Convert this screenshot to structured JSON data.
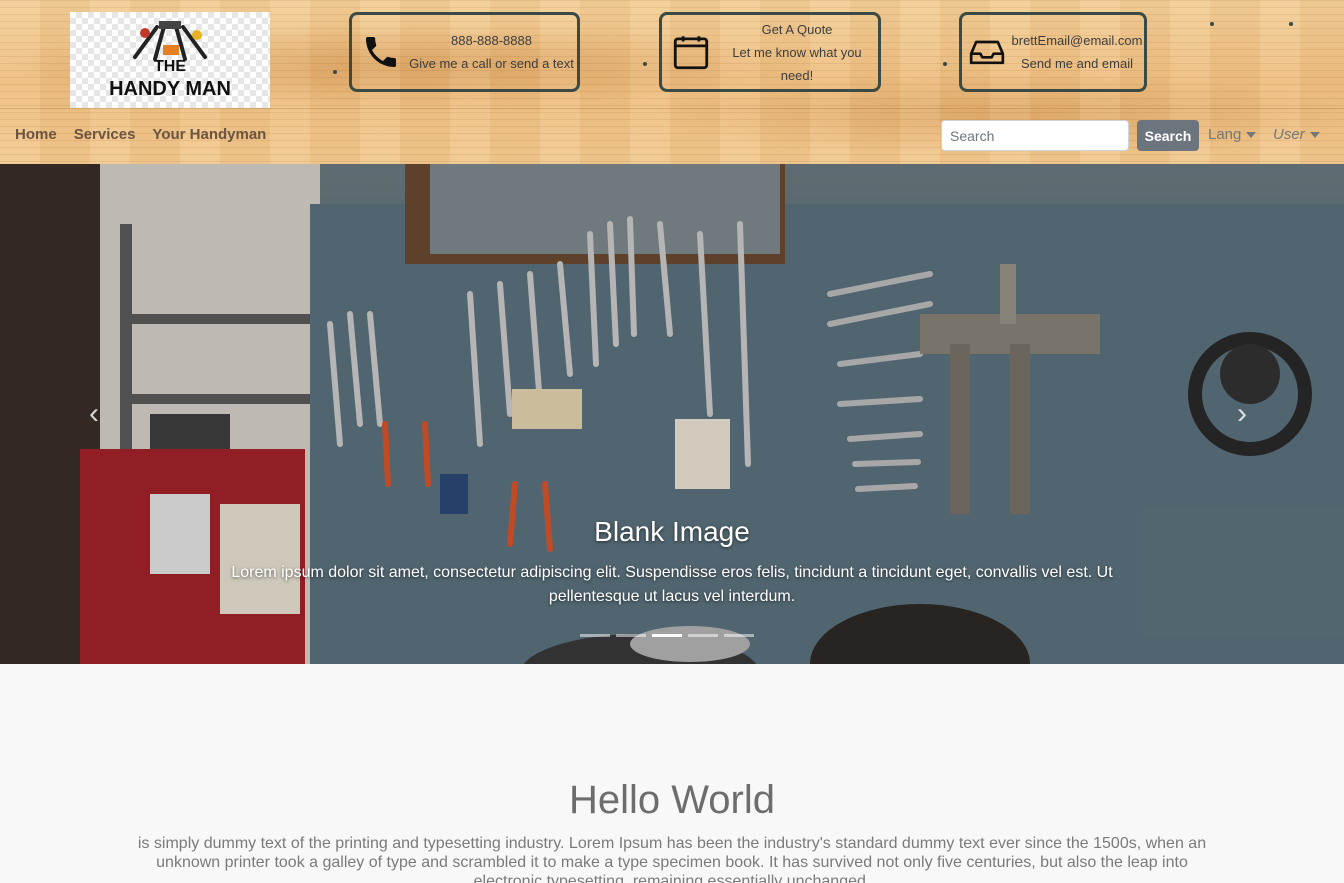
{
  "brand": {
    "logo_line1": "THE",
    "logo_line2": "HANDY MAN"
  },
  "contacts": [
    {
      "icon": "phone-icon",
      "line1": "888-888-8888",
      "line2": "Give me a call or send a text"
    },
    {
      "icon": "calendar-icon",
      "line1": "Get A Quote",
      "line2": "Let me know what you need!"
    },
    {
      "icon": "inbox-icon",
      "line1": "brettEmail@email.com",
      "line2": "Send me and email"
    }
  ],
  "nav": {
    "items": [
      "Home",
      "Services",
      "Your Handyman"
    ]
  },
  "search": {
    "placeholder": "Search",
    "button": "Search"
  },
  "dropdowns": {
    "lang": "Lang",
    "user": "User"
  },
  "carousel": {
    "title": "Blank Image",
    "text": "Lorem ipsum dolor sit amet, consectetur adipiscing elit. Suspendisse eros felis, tincidunt a tincidunt eget, convallis vel est. Ut pellentesque ut lacus vel interdum.",
    "slides": 5,
    "active_index": 2
  },
  "hello": {
    "title": "Hello World",
    "text": "is simply dummy text of the printing and typesetting industry. Lorem Ipsum has been the industry's standard dummy text ever since the 1500s, when an unknown printer took a galley of type and scrambled it to make a type specimen book. It has survived not only five centuries, but also the leap into electronic typesetting, remaining essentially unchanged."
  },
  "colors": {
    "wood": "#f0c88c",
    "box_border": "#3c4a45",
    "nav_link": "#6b5440",
    "button": "#6c757d"
  }
}
